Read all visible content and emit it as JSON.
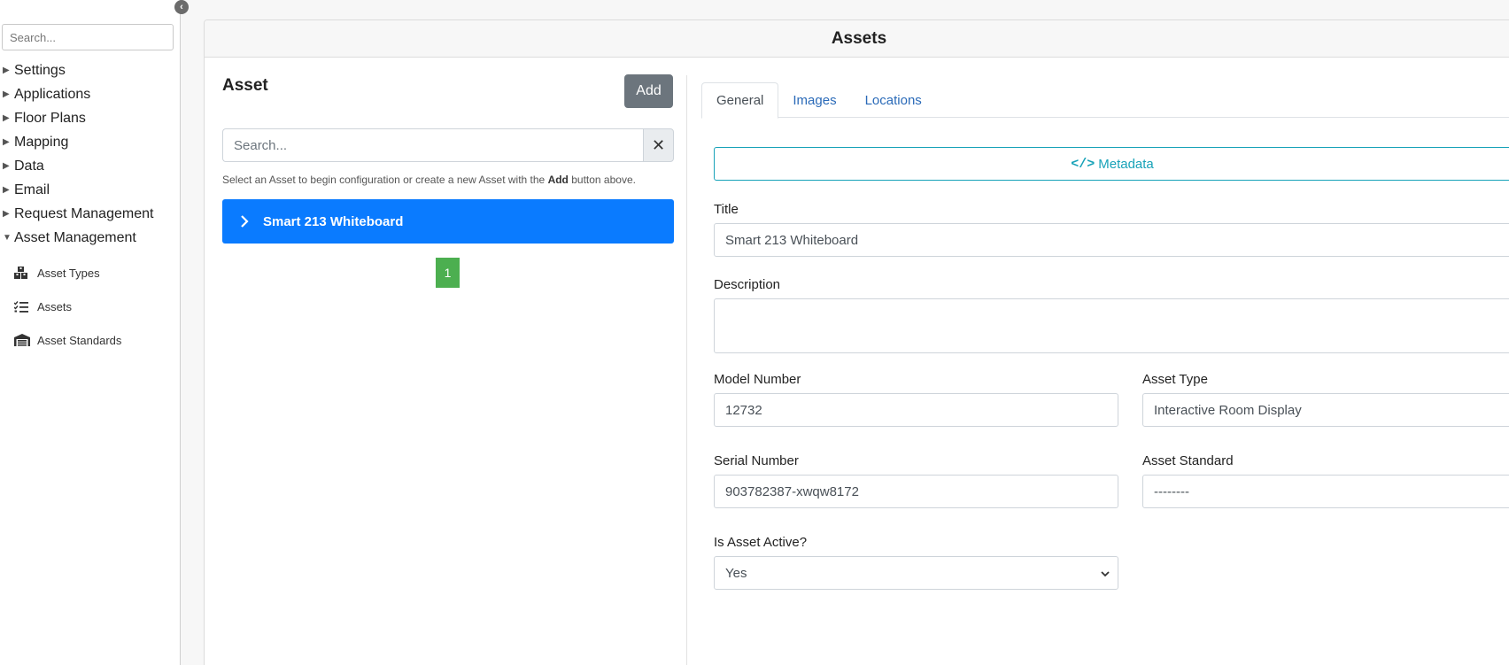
{
  "sidebar": {
    "search_placeholder": "Search...",
    "items": [
      {
        "label": "Settings"
      },
      {
        "label": "Applications"
      },
      {
        "label": "Floor Plans"
      },
      {
        "label": "Mapping"
      },
      {
        "label": "Data"
      },
      {
        "label": "Email"
      },
      {
        "label": "Request Management"
      },
      {
        "label": "Asset Management"
      }
    ],
    "subitems": [
      {
        "label": "Asset Types",
        "icon": "boxes-icon"
      },
      {
        "label": "Assets",
        "icon": "list-check-icon"
      },
      {
        "label": "Asset Standards",
        "icon": "warehouse-icon"
      }
    ]
  },
  "page": {
    "title": "Assets"
  },
  "asset_panel": {
    "title": "Asset",
    "add_label": "Add",
    "search_placeholder": "Search...",
    "clear_label": "✕",
    "help_prefix": "Select an Asset to begin configuration or create a new Asset with the ",
    "help_bold": "Add",
    "help_suffix": " button above.",
    "list": [
      {
        "label": "Smart 213 Whiteboard"
      }
    ],
    "pagination": [
      "1"
    ]
  },
  "detail": {
    "tabs": [
      {
        "label": "General",
        "active": true
      },
      {
        "label": "Images",
        "active": false
      },
      {
        "label": "Locations",
        "active": false
      }
    ],
    "metadata_label": "Metadata",
    "fields": {
      "title_label": "Title",
      "title_value": "Smart 213 Whiteboard",
      "description_label": "Description",
      "description_value": "",
      "model_label": "Model Number",
      "model_value": "12732",
      "asset_type_label": "Asset Type",
      "asset_type_value": "Interactive Room Display",
      "serial_label": "Serial Number",
      "serial_value": "903782387-xwqw8172",
      "asset_standard_label": "Asset Standard",
      "asset_standard_value": "--------",
      "active_label": "Is Asset Active?",
      "active_value": "Yes"
    }
  },
  "colors": {
    "primary": "#0a7bff",
    "secondary": "#6c757d",
    "info": "#17a2b8",
    "success": "#4caf50",
    "link": "#2a6ab8"
  }
}
